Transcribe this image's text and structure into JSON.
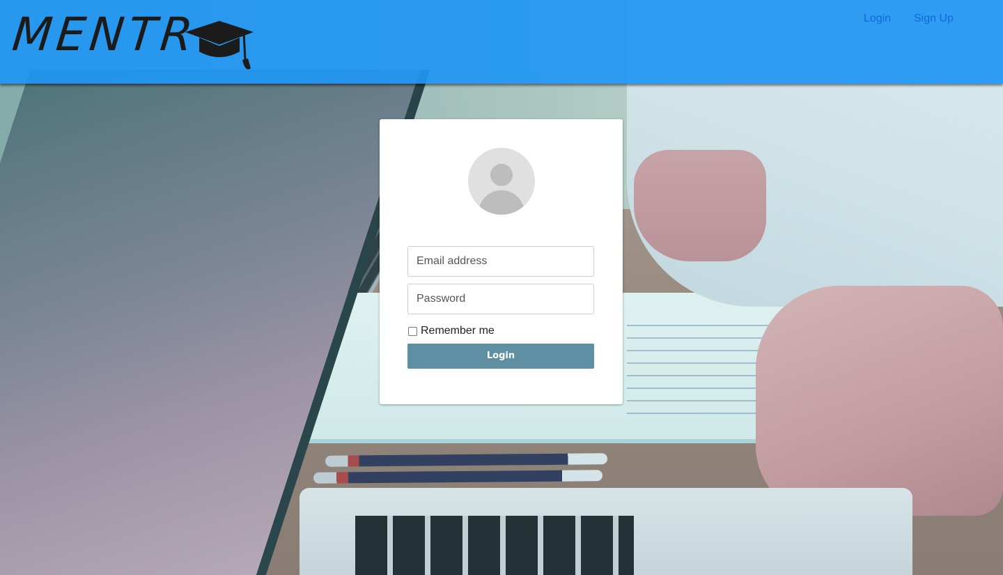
{
  "header": {
    "logo_text": "MENTR",
    "nav": {
      "login_label": "Login",
      "signup_label": "Sign Up"
    }
  },
  "login_form": {
    "email": {
      "placeholder": "Email address",
      "value": ""
    },
    "password": {
      "placeholder": "Password",
      "value": ""
    },
    "remember_label": "Remember me",
    "remember_checked": false,
    "submit_label": "Login"
  },
  "colors": {
    "header_bg": "#2096F3",
    "nav_link": "#1565D8",
    "button_bg": "#5F8FA3",
    "card_bg": "#FFFFFF",
    "avatar_bg": "#E0E0E0"
  },
  "icons": {
    "logo_icon": "graduation-cap-icon",
    "avatar_icon": "user-avatar-icon"
  }
}
